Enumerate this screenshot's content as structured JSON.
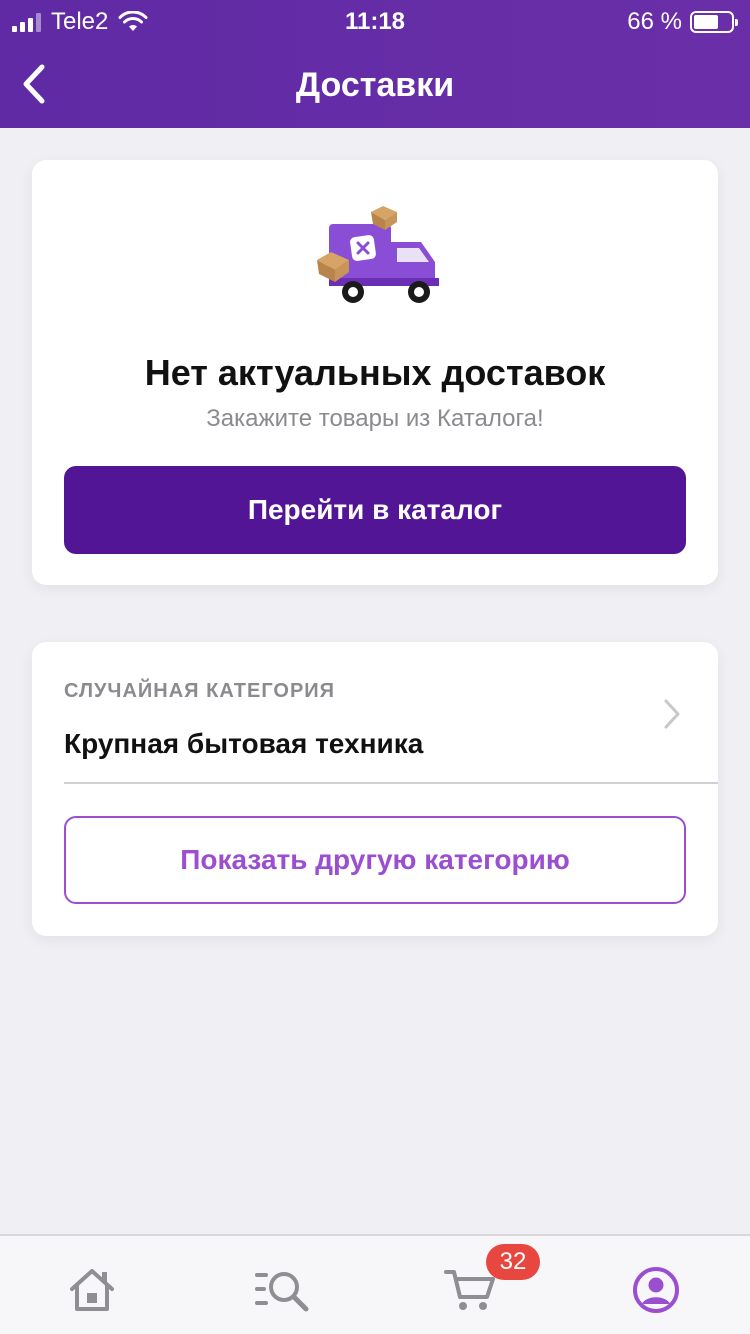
{
  "status_bar": {
    "carrier": "Tele2",
    "time": "11:18",
    "battery": "66 %",
    "battery_level": 0.66
  },
  "header": {
    "title": "Доставки",
    "back_icon": "chevron-left-icon"
  },
  "empty_state": {
    "illustration": "delivery-truck-icon",
    "title": "Нет актуальных доставок",
    "subtitle": "Закажите товары из Каталога!",
    "button_label": "Перейти в каталог"
  },
  "random_category": {
    "caption": "СЛУЧАЙНАЯ КАТЕГОРИЯ",
    "name": "Крупная бытовая техника",
    "button_label": "Показать другую категорию"
  },
  "tabbar": {
    "items": [
      {
        "icon": "home-icon"
      },
      {
        "icon": "catalog-search-icon"
      },
      {
        "icon": "cart-icon",
        "badge": "32"
      },
      {
        "icon": "profile-icon",
        "active": true
      }
    ]
  },
  "colors": {
    "header": "#5f2aa4",
    "primary_button": "#521595",
    "accent": "#9b4fd0",
    "badge": "#e8473f",
    "background": "#efeff4"
  }
}
